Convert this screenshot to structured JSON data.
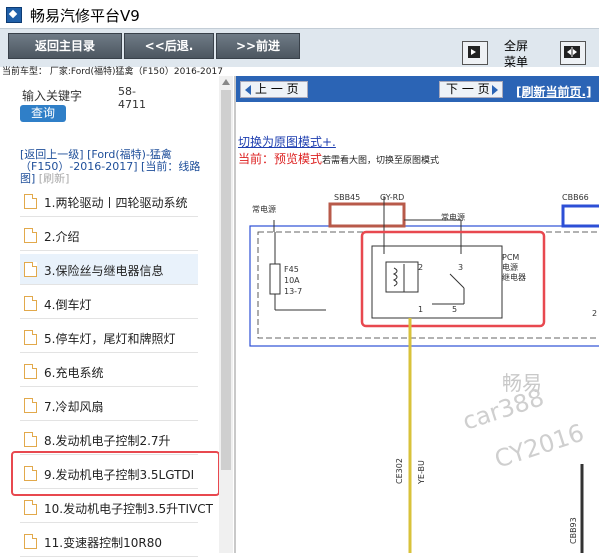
{
  "window": {
    "title": "畅易汽修平台V9"
  },
  "toolbar": {
    "main_menu": "返回主目录",
    "back": "<<后退.",
    "forward": ">>前进",
    "fullscreen_line1": "全屏",
    "fullscreen_line2": "菜单"
  },
  "model_line": "当前车型： 厂家:Ford(福特)猛禽（F150）2016-2017",
  "search": {
    "keyword_label": "输入关键字",
    "keyword_value": "58-4711",
    "button": "查询"
  },
  "breadcrumb": {
    "back_link": "[返回上一级]",
    "path": "[Ford(福特)-猛禽（F150）-2016-2017]",
    "current": "[当前：线路图]",
    "refresh": "[刷新]"
  },
  "menu_items": [
    "1.两轮驱动丨四轮驱动系统",
    "2.介绍",
    "3.保险丝与继电器信息",
    "4.倒车灯",
    "5.停车灯，尾灯和牌照灯",
    "6.充电系统",
    "7.冷却风扇",
    "8.发动机电子控制2.7升",
    "9.发动机电子控制3.5LGTDI",
    "10.发动机电子控制3.5升TIVCT",
    "11.变速器控制10R80"
  ],
  "right_panel": {
    "prev_page": "上 一 页",
    "next_page": "下 一 页",
    "refresh_page": "[刷新当前页.]",
    "switch_mode": "切换为原图模式+.",
    "preview_prefix": "当前：预览模式",
    "preview_tip": "若需看大图，切换至原图模式"
  },
  "diagram": {
    "labels": {
      "power_left": "常电源",
      "sbb45": "SBB45",
      "gy_rd": "GY-RD",
      "power_mid": "常电源",
      "cbb66": "CBB66",
      "fuse_f45": "F45",
      "fuse_amp": "10A",
      "fuse_loc": "13-7",
      "pin2": "2",
      "pin3": "3",
      "pin1": "1",
      "pin5": "5",
      "pcm_line1": "PCM",
      "pcm_line2": "电源",
      "pcm_line3": "继电器",
      "ce302": "CE302",
      "ye_bu": "YE-BU",
      "cbb93": "CBB93",
      "edge_num": "2",
      "wm_chang": "畅易",
      "wm_car": "car388",
      "wm_cy": "CY2016"
    },
    "colors": {
      "box_blue": "#2d4fd6",
      "wire_red": "#b85a4a",
      "wire_yellow": "#d8c23a",
      "highlight": "#e8484f"
    }
  }
}
